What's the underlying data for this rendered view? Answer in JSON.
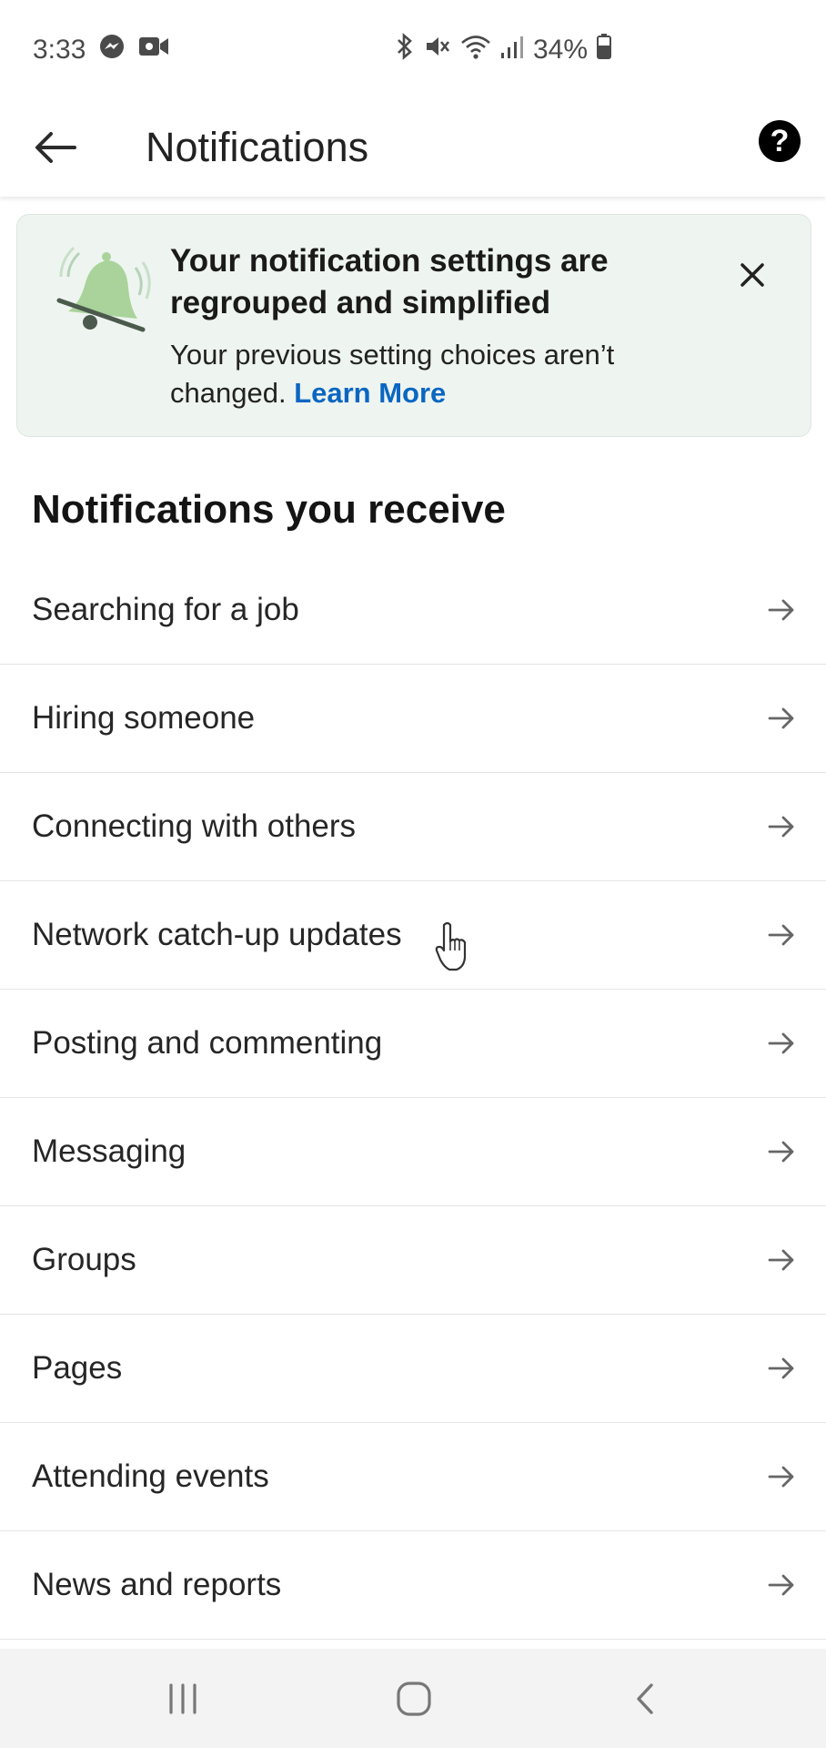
{
  "status_bar": {
    "time": "3:33",
    "battery": "34%",
    "icons": [
      "messenger-icon",
      "video-icon",
      "bluetooth-icon",
      "mute-icon",
      "wifi-icon",
      "signal-icon",
      "battery-icon"
    ]
  },
  "app_bar": {
    "title": "Notifications",
    "back_icon": "arrow-left-icon",
    "help_label": "?"
  },
  "banner": {
    "title": "Your notification settings are regrouped and simplified",
    "text": "Your previous setting choices aren’t changed.",
    "link": "Learn More",
    "icon": "bell-icon",
    "accent": "#0a66c2"
  },
  "section": {
    "title": "Notifications you receive"
  },
  "items": [
    {
      "label": "Searching for a job"
    },
    {
      "label": "Hiring someone"
    },
    {
      "label": "Connecting with others"
    },
    {
      "label": "Network catch-up updates"
    },
    {
      "label": "Posting and commenting"
    },
    {
      "label": "Messaging"
    },
    {
      "label": "Groups"
    },
    {
      "label": "Pages"
    },
    {
      "label": "Attending events"
    },
    {
      "label": "News and reports"
    }
  ],
  "nav_bar": {
    "buttons": [
      "recents-icon",
      "home-icon",
      "back-icon"
    ]
  }
}
